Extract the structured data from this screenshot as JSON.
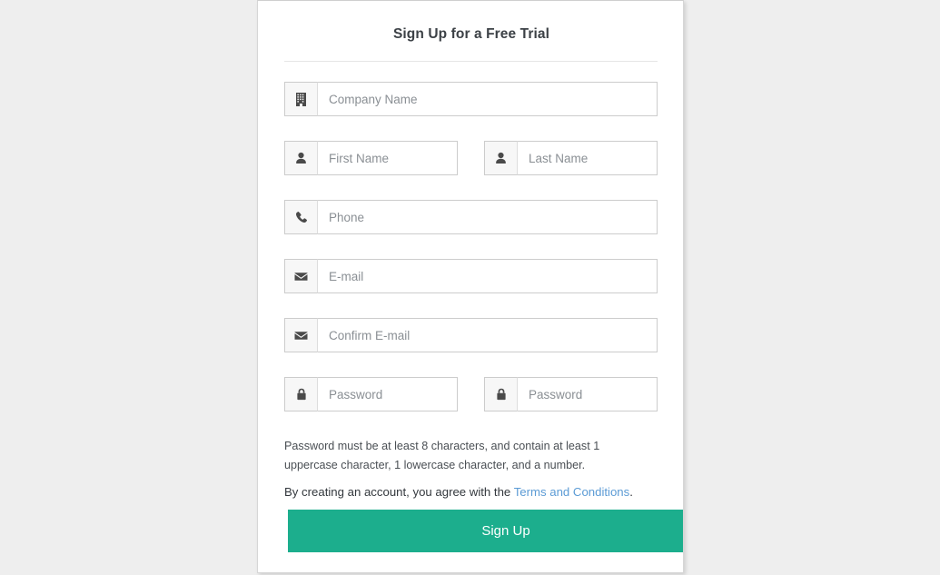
{
  "page": {
    "background_color": "#eeeeee"
  },
  "card": {
    "title": "Sign Up for a Free Trial",
    "background_color": "#ffffff",
    "border_color": "#d6d6d6"
  },
  "form": {
    "fields": [
      {
        "name": "company-name",
        "icon": "building-icon",
        "placeholder": "Company Name",
        "value": "",
        "type": "text",
        "width": "full"
      },
      {
        "name": "first-name",
        "icon": "user-icon",
        "placeholder": "First Name",
        "value": "",
        "type": "text",
        "width": "half"
      },
      {
        "name": "last-name",
        "icon": "user-icon",
        "placeholder": "Last Name",
        "value": "",
        "type": "text",
        "width": "half"
      },
      {
        "name": "phone",
        "icon": "phone-icon",
        "placeholder": "Phone",
        "value": "",
        "type": "tel",
        "width": "full"
      },
      {
        "name": "email",
        "icon": "envelope-icon",
        "placeholder": "E-mail",
        "value": "",
        "type": "email",
        "width": "full"
      },
      {
        "name": "confirm-email",
        "icon": "envelope-icon",
        "placeholder": "Confirm E-mail",
        "value": "",
        "type": "email",
        "width": "full"
      },
      {
        "name": "password",
        "icon": "lock-icon",
        "placeholder": "Password",
        "value": "",
        "type": "password",
        "width": "half"
      },
      {
        "name": "confirm-password",
        "icon": "lock-icon",
        "placeholder": "Password",
        "value": "",
        "type": "password",
        "width": "half"
      }
    ],
    "password_help": "Password must be at least 8 characters, and contain at least 1 uppercase character, 1 lowercase character, and a number.",
    "terms": {
      "prefix": "By creating an account, you agree with the ",
      "link_label": "Terms and Conditions",
      "suffix": ".",
      "link_color": "#5b9bd5"
    },
    "submit": {
      "label": "Sign Up",
      "color": "#1cae8d",
      "text_color": "#ffffff"
    }
  }
}
